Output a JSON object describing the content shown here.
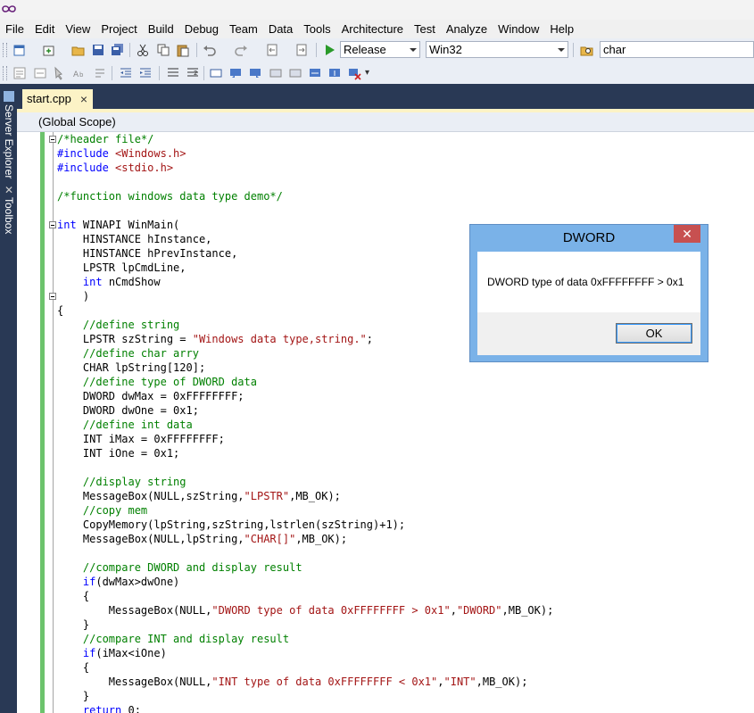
{
  "menu": [
    "File",
    "Edit",
    "View",
    "Project",
    "Build",
    "Debug",
    "Team",
    "Data",
    "Tools",
    "Architecture",
    "Test",
    "Analyze",
    "Window",
    "Help"
  ],
  "toolbar": {
    "configuration": "Release",
    "platform": "Win32",
    "find_text": "char"
  },
  "side_tabs": [
    "Server Explorer",
    "Toolbox"
  ],
  "document_tab": {
    "name": "start.cpp",
    "close": "×"
  },
  "scope": "(Global Scope)",
  "dialog": {
    "title": "DWORD",
    "close": "✕",
    "message": "DWORD type of data 0xFFFFFFFF > 0x1",
    "ok_label": "OK"
  },
  "code_lines": [
    [
      [
        "c",
        "/*header file*/"
      ]
    ],
    [
      [
        "k",
        "#include"
      ],
      [
        "p",
        " "
      ],
      [
        "s",
        "<Windows.h>"
      ]
    ],
    [
      [
        "k",
        "#include"
      ],
      [
        "p",
        " "
      ],
      [
        "s",
        "<stdio.h>"
      ]
    ],
    [],
    [
      [
        "c",
        "/*function windows data type demo*/"
      ]
    ],
    [],
    [
      [
        "k",
        "int"
      ],
      [
        "p",
        " WINAPI WinMain("
      ]
    ],
    [
      [
        "p",
        "    HINSTANCE hInstance,"
      ]
    ],
    [
      [
        "p",
        "    HINSTANCE hPrevInstance,"
      ]
    ],
    [
      [
        "p",
        "    LPSTR lpCmdLine,"
      ]
    ],
    [
      [
        "p",
        "    "
      ],
      [
        "k",
        "int"
      ],
      [
        "p",
        " nCmdShow"
      ]
    ],
    [
      [
        "p",
        "    )"
      ]
    ],
    [
      [
        "p",
        "{"
      ]
    ],
    [
      [
        "p",
        "    "
      ],
      [
        "c",
        "//define string"
      ]
    ],
    [
      [
        "p",
        "    LPSTR szString = "
      ],
      [
        "s",
        "\"Windows data type,string.\""
      ],
      [
        "p",
        ";"
      ]
    ],
    [
      [
        "p",
        "    "
      ],
      [
        "c",
        "//define char arry"
      ]
    ],
    [
      [
        "p",
        "    CHAR lpString[120];"
      ]
    ],
    [
      [
        "p",
        "    "
      ],
      [
        "c",
        "//define type of DWORD data"
      ]
    ],
    [
      [
        "p",
        "    DWORD dwMax = 0xFFFFFFFF;"
      ]
    ],
    [
      [
        "p",
        "    DWORD dwOne = 0x1;"
      ]
    ],
    [
      [
        "p",
        "    "
      ],
      [
        "c",
        "//define int data"
      ]
    ],
    [
      [
        "p",
        "    INT iMax = 0xFFFFFFFF;"
      ]
    ],
    [
      [
        "p",
        "    INT iOne = 0x1;"
      ]
    ],
    [],
    [
      [
        "p",
        "    "
      ],
      [
        "c",
        "//display string"
      ]
    ],
    [
      [
        "p",
        "    MessageBox(NULL,szString,"
      ],
      [
        "s",
        "\"LPSTR\""
      ],
      [
        "p",
        ",MB_OK);"
      ]
    ],
    [
      [
        "p",
        "    "
      ],
      [
        "c",
        "//copy mem"
      ]
    ],
    [
      [
        "p",
        "    CopyMemory(lpString,szString,lstrlen(szString)+1);"
      ]
    ],
    [
      [
        "p",
        "    MessageBox(NULL,lpString,"
      ],
      [
        "s",
        "\"CHAR[]\""
      ],
      [
        "p",
        ",MB_OK);"
      ]
    ],
    [],
    [
      [
        "p",
        "    "
      ],
      [
        "c",
        "//compare DWORD and display result"
      ]
    ],
    [
      [
        "p",
        "    "
      ],
      [
        "k",
        "if"
      ],
      [
        "p",
        "(dwMax>dwOne)"
      ]
    ],
    [
      [
        "p",
        "    {"
      ]
    ],
    [
      [
        "p",
        "        MessageBox(NULL,"
      ],
      [
        "s",
        "\"DWORD type of data 0xFFFFFFFF > 0x1\""
      ],
      [
        "p",
        ","
      ],
      [
        "s",
        "\"DWORD\""
      ],
      [
        "p",
        ",MB_OK);"
      ]
    ],
    [
      [
        "p",
        "    }"
      ]
    ],
    [
      [
        "p",
        "    "
      ],
      [
        "c",
        "//compare INT and display result"
      ]
    ],
    [
      [
        "p",
        "    "
      ],
      [
        "k",
        "if"
      ],
      [
        "p",
        "(iMax<iOne)"
      ]
    ],
    [
      [
        "p",
        "    {"
      ]
    ],
    [
      [
        "p",
        "        MessageBox(NULL,"
      ],
      [
        "s",
        "\"INT type of data 0xFFFFFFFF < 0x1\""
      ],
      [
        "p",
        ","
      ],
      [
        "s",
        "\"INT\""
      ],
      [
        "p",
        ",MB_OK);"
      ]
    ],
    [
      [
        "p",
        "    }"
      ]
    ],
    [
      [
        "p",
        "    "
      ],
      [
        "k",
        "return"
      ],
      [
        "p",
        " 0;"
      ]
    ]
  ],
  "colors": {
    "comment": "#008000",
    "keyword": "#0000ff",
    "string": "#a31515",
    "ide_background": "#293955",
    "tab_active": "#fcf3c6"
  },
  "icons": [
    "new-project-icon",
    "add-item-icon",
    "open-file-icon",
    "save-icon",
    "save-all-icon",
    "cut-icon",
    "copy-icon",
    "paste-icon",
    "undo-icon",
    "redo-icon",
    "navigate-back-icon",
    "navigate-forward-icon",
    "start-debugging-icon",
    "find-in-files-icon"
  ]
}
